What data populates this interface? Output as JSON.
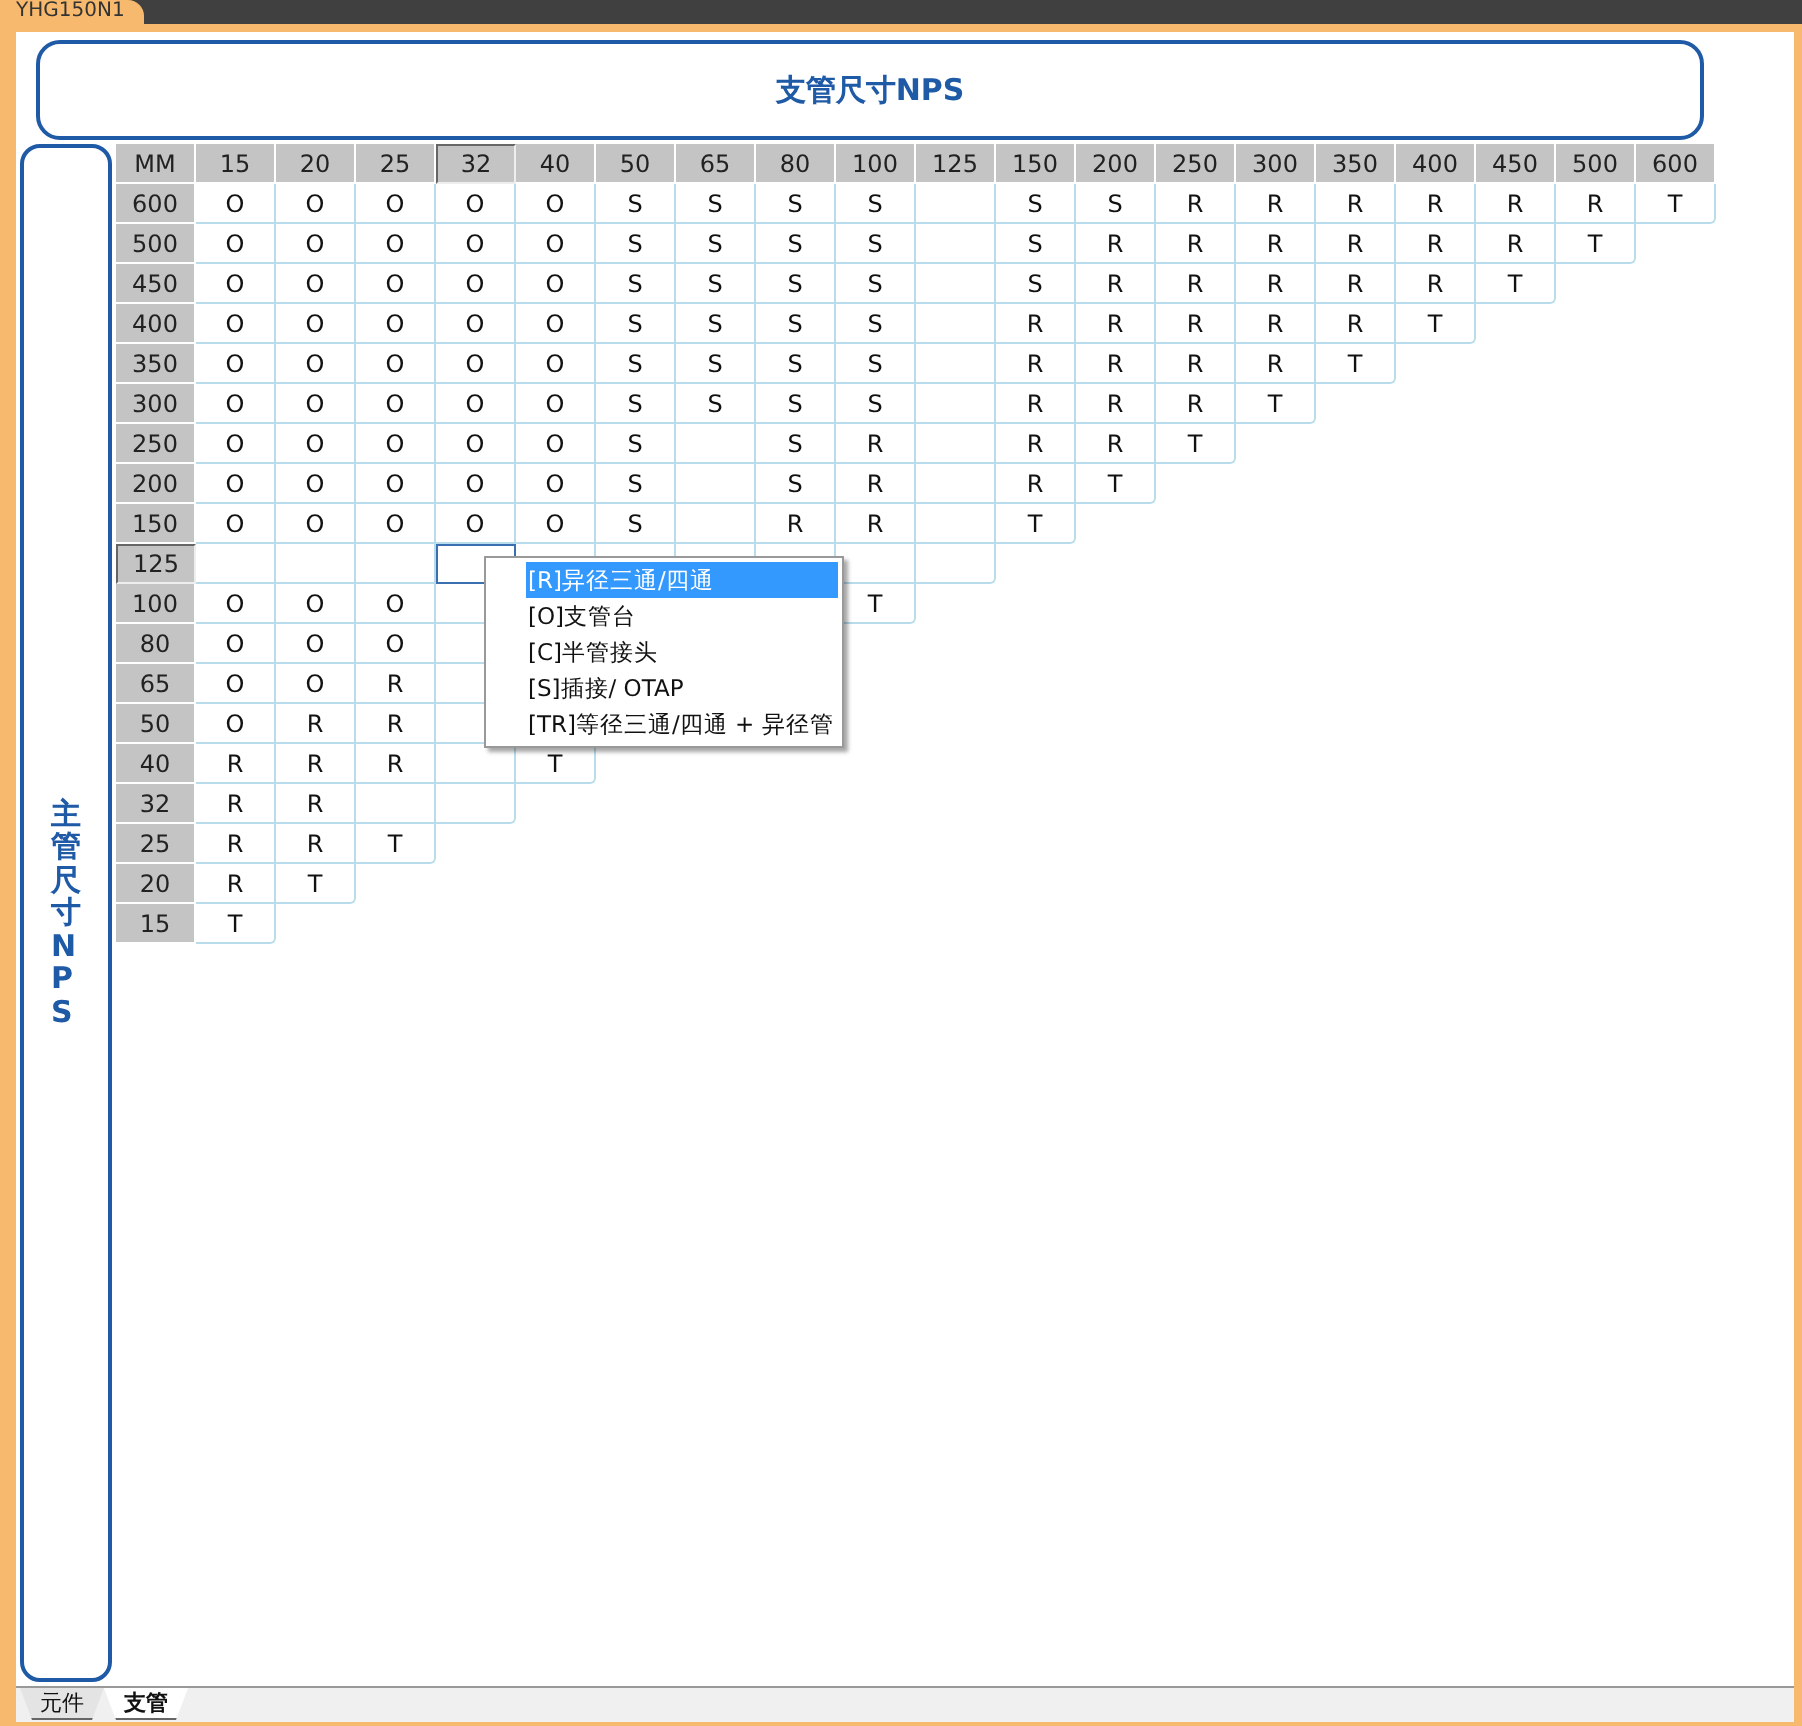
{
  "document_tab": {
    "label": "YHG150N1"
  },
  "branch_header": {
    "title": "支管尺寸NPS"
  },
  "main_header": {
    "title": "主管尺寸NPS"
  },
  "table": {
    "corner": "MM",
    "columns": [
      {
        "label": "15",
        "selected": false
      },
      {
        "label": "20",
        "selected": false
      },
      {
        "label": "25",
        "selected": false
      },
      {
        "label": "32",
        "selected": true
      },
      {
        "label": "40",
        "selected": false
      },
      {
        "label": "50",
        "selected": false
      },
      {
        "label": "65",
        "selected": false
      },
      {
        "label": "80",
        "selected": false
      },
      {
        "label": "100",
        "selected": false
      },
      {
        "label": "125",
        "selected": false
      },
      {
        "label": "150",
        "selected": false
      },
      {
        "label": "200",
        "selected": false
      },
      {
        "label": "250",
        "selected": false
      },
      {
        "label": "300",
        "selected": false
      },
      {
        "label": "350",
        "selected": false
      },
      {
        "label": "400",
        "selected": false
      },
      {
        "label": "450",
        "selected": false
      },
      {
        "label": "500",
        "selected": false
      },
      {
        "label": "600",
        "selected": false
      }
    ],
    "rows": [
      {
        "size": "600",
        "selected": false,
        "cells": [
          "O",
          "O",
          "O",
          "O",
          "O",
          "S",
          "S",
          "S",
          "S",
          null,
          "S",
          "S",
          "R",
          "R",
          "R",
          "R",
          "R",
          "R",
          "T"
        ]
      },
      {
        "size": "500",
        "selected": false,
        "cells": [
          "O",
          "O",
          "O",
          "O",
          "O",
          "S",
          "S",
          "S",
          "S",
          null,
          "S",
          "R",
          "R",
          "R",
          "R",
          "R",
          "R",
          "T"
        ]
      },
      {
        "size": "450",
        "selected": false,
        "cells": [
          "O",
          "O",
          "O",
          "O",
          "O",
          "S",
          "S",
          "S",
          "S",
          null,
          "S",
          "R",
          "R",
          "R",
          "R",
          "R",
          "T"
        ]
      },
      {
        "size": "400",
        "selected": false,
        "cells": [
          "O",
          "O",
          "O",
          "O",
          "O",
          "S",
          "S",
          "S",
          "S",
          null,
          "R",
          "R",
          "R",
          "R",
          "R",
          "T"
        ]
      },
      {
        "size": "350",
        "selected": false,
        "cells": [
          "O",
          "O",
          "O",
          "O",
          "O",
          "S",
          "S",
          "S",
          "S",
          null,
          "R",
          "R",
          "R",
          "R",
          "T"
        ]
      },
      {
        "size": "300",
        "selected": false,
        "cells": [
          "O",
          "O",
          "O",
          "O",
          "O",
          "S",
          "S",
          "S",
          "S",
          null,
          "R",
          "R",
          "R",
          "T"
        ]
      },
      {
        "size": "250",
        "selected": false,
        "cells": [
          "O",
          "O",
          "O",
          "O",
          "O",
          "S",
          null,
          "S",
          "R",
          null,
          "R",
          "R",
          "T"
        ]
      },
      {
        "size": "200",
        "selected": false,
        "cells": [
          "O",
          "O",
          "O",
          "O",
          "O",
          "S",
          null,
          "S",
          "R",
          null,
          "R",
          "T"
        ]
      },
      {
        "size": "150",
        "selected": false,
        "cells": [
          "O",
          "O",
          "O",
          "O",
          "O",
          "S",
          null,
          "R",
          "R",
          null,
          "T"
        ]
      },
      {
        "size": "125",
        "selected": true,
        "cells": [
          null,
          null,
          null,
          null,
          null,
          null,
          null,
          null,
          null,
          null
        ]
      },
      {
        "size": "100",
        "selected": false,
        "cells": [
          "O",
          "O",
          "O",
          null,
          null,
          null,
          null,
          null,
          "T"
        ]
      },
      {
        "size": "80",
        "selected": false,
        "cells": [
          "O",
          "O",
          "O",
          null,
          null,
          null,
          null,
          null
        ]
      },
      {
        "size": "65",
        "selected": false,
        "cells": [
          "O",
          "O",
          "R",
          null,
          null,
          null,
          null
        ]
      },
      {
        "size": "50",
        "selected": false,
        "cells": [
          "O",
          "R",
          "R",
          null,
          null,
          null
        ]
      },
      {
        "size": "40",
        "selected": false,
        "cells": [
          "R",
          "R",
          "R",
          null,
          "T"
        ]
      },
      {
        "size": "32",
        "selected": false,
        "cells": [
          "R",
          "R",
          null,
          null
        ]
      },
      {
        "size": "25",
        "selected": false,
        "cells": [
          "R",
          "R",
          "T"
        ]
      },
      {
        "size": "20",
        "selected": false,
        "cells": [
          "R",
          "T"
        ]
      },
      {
        "size": "15",
        "selected": false,
        "cells": [
          "T"
        ]
      }
    ]
  },
  "context_menu": {
    "items": [
      {
        "label": "[R]异径三通/四通",
        "selected": true
      },
      {
        "label": "[O]支管台",
        "selected": false
      },
      {
        "label": "[C]半管接头",
        "selected": false
      },
      {
        "label": "[S]插接/ OTAP",
        "selected": false
      },
      {
        "label": "[TR]等径三通/四通 + 异径管",
        "selected": false
      }
    ]
  },
  "sheet_tabs": [
    {
      "label": "元件",
      "selected": false
    },
    {
      "label": "支管",
      "selected": true
    }
  ]
}
